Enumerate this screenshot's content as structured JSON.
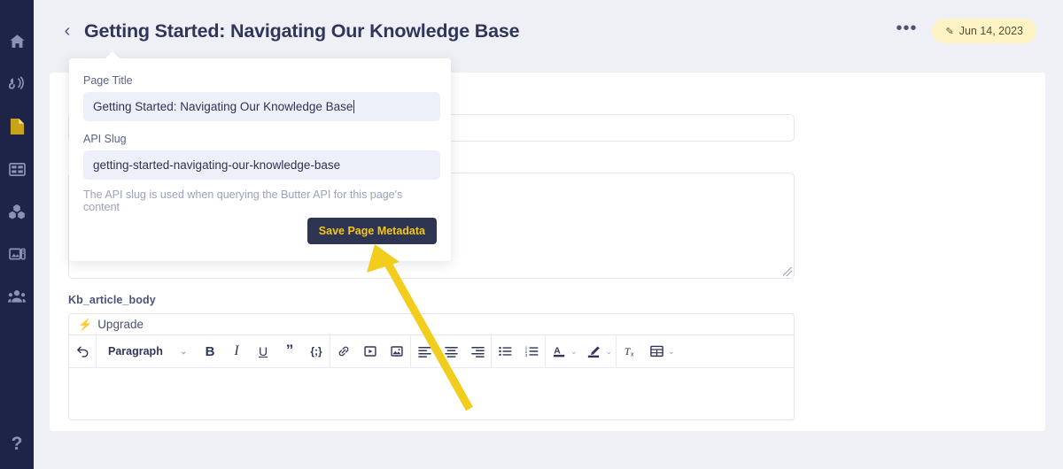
{
  "sidebar": {
    "items": [
      {
        "name": "home",
        "label": "Home"
      },
      {
        "name": "blog",
        "label": "Blog"
      },
      {
        "name": "pages",
        "label": "Pages"
      },
      {
        "name": "collections",
        "label": "Collections"
      },
      {
        "name": "components",
        "label": "Components"
      },
      {
        "name": "media",
        "label": "Media"
      },
      {
        "name": "team",
        "label": "Team"
      }
    ],
    "help_glyph": "?"
  },
  "header": {
    "back_glyph": "‹",
    "title": "Getting Started: Navigating Our Knowledge Base",
    "overflow_glyph": "•••",
    "date_badge": {
      "pencil_glyph": "✎",
      "text": "Jun 14, 2023"
    }
  },
  "modal": {
    "title_label": "Page Title",
    "title_value": "Getting Started: Navigating Our Knowledge Base",
    "slug_label": "API Slug",
    "slug_value": "getting-started-navigating-our-knowledge-base",
    "hint": "The API slug is used when querying the Butter API for this page's content",
    "save_label": "Save Page Metadata",
    "save_bg": "#2e3552",
    "save_fg": "#f5c518"
  },
  "editor": {
    "field_label": "Kb_article_body",
    "upgrade_label": "Upgrade",
    "bolt_glyph": "⚡",
    "paragraph_label": "Paragraph",
    "chevron_glyph": "⌄",
    "buttons": [
      {
        "name": "undo",
        "glyph": "↩"
      },
      {
        "name": "bold",
        "glyph": "B"
      },
      {
        "name": "italic",
        "glyph": "I"
      },
      {
        "name": "underline",
        "glyph": "U"
      },
      {
        "name": "blockquote",
        "glyph": "”"
      },
      {
        "name": "code",
        "glyph": "{;}"
      },
      {
        "name": "link",
        "glyph": "link"
      },
      {
        "name": "video",
        "glyph": "video"
      },
      {
        "name": "image",
        "glyph": "image"
      },
      {
        "name": "align-left",
        "glyph": "align-left"
      },
      {
        "name": "align-center",
        "glyph": "align-center"
      },
      {
        "name": "align-right",
        "glyph": "align-right"
      },
      {
        "name": "bullet-list",
        "glyph": "bullet-list"
      },
      {
        "name": "numbered-list",
        "glyph": "numbered-list"
      },
      {
        "name": "text-color",
        "glyph": "A"
      },
      {
        "name": "highlight",
        "glyph": "pen"
      },
      {
        "name": "clear-format",
        "glyph": "Tx"
      },
      {
        "name": "table",
        "glyph": "table"
      }
    ],
    "body_text": ""
  },
  "fields": {
    "input_value": "",
    "textarea_value": ""
  },
  "annotation": {
    "arrow_color": "#f2cd1b"
  },
  "colors": {
    "sidebar_bg": "#1e2448",
    "page_bg": "#eef0f5",
    "panel_bg": "#ffffff",
    "accent_navy": "#2f3659",
    "accent_yellow": "#f5c518",
    "badge_bg": "#fdf3c4"
  }
}
